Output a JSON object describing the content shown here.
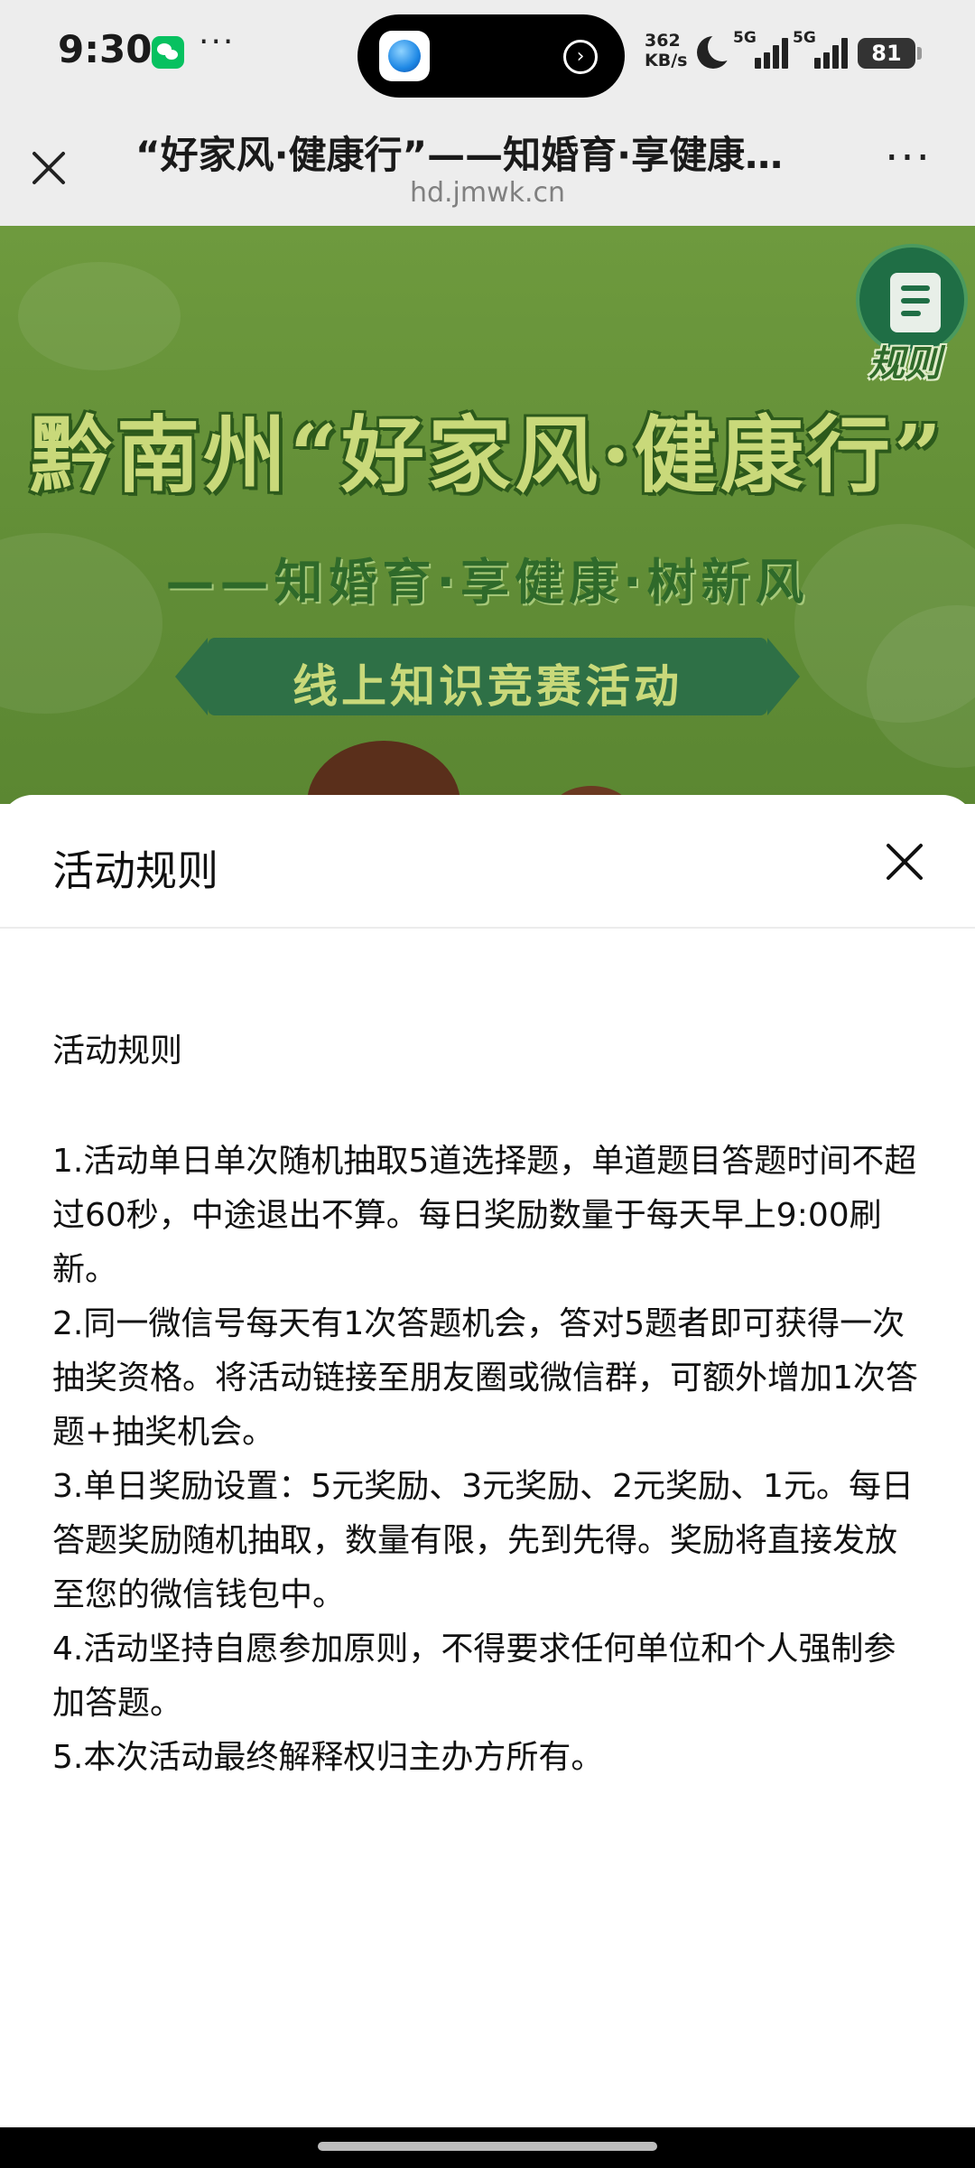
{
  "status_bar": {
    "time": "9:30",
    "more": "···",
    "net_speed_value": "362",
    "net_speed_unit": "KB/s",
    "signal_1_label": "5G",
    "signal_2_label": "5G",
    "battery_level": "81"
  },
  "browser": {
    "title": "“好家风·健康行”——知婚育·享健康…",
    "url": "hd.jmwk.cn",
    "more": "···"
  },
  "banner": {
    "title": "黔南州“好家风·健康行”",
    "subtitle": "——知婚育·享健康·树新风",
    "ribbon": "线上知识竞赛活动",
    "rules_button": "规则",
    "color_primary": "#618d36",
    "color_accent": "#2e7046"
  },
  "sheet": {
    "title": "活动规则",
    "heading": "活动规则",
    "rules": [
      "1.活动单日单次随机抽取5道选择题，单道题目答题时间不超过60秒，中途退出不算。每日奖励数量于每天早上9:00刷新。",
      "2.同一微信号每天有1次答题机会，答对5题者即可获得一次抽奖资格。将活动链接至朋友圈或微信群，可额外增加1次答题+抽奖机会。",
      "3.单日奖励设置：5元奖励、3元奖励、2元奖励、1元。每日答题奖励随机抽取，数量有限，先到先得。奖励将直接发放至您的微信钱包中。",
      "4.活动坚持自愿参加原则，不得要求任何单位和个人强制参加答题。",
      "5.本次活动最终解释权归主办方所有。"
    ]
  }
}
